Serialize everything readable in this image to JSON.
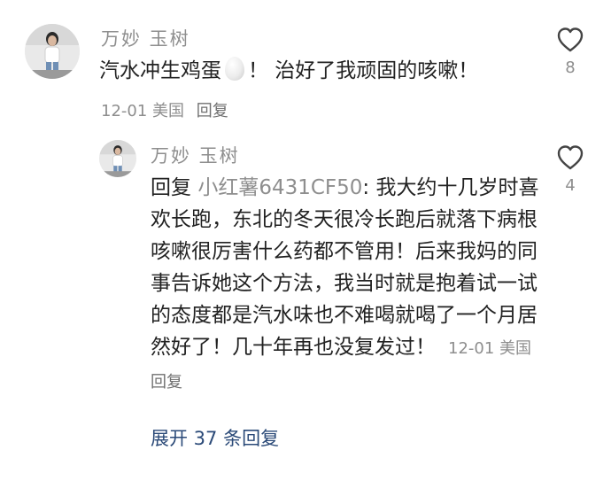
{
  "comment": {
    "username": "万妙 玉树",
    "text_before_emoji": "汽水冲生鸡蛋",
    "emoji": "egg-emoji",
    "text_after_emoji": "！ 治好了我顽固的咳嗽！",
    "date": "12-01",
    "location": "美国",
    "reply_label": "回复",
    "like_count": "8",
    "reply": {
      "username": "万妙 玉树",
      "reply_prefix": "回复",
      "mention": "小红薯6431CF50",
      "text": ": 我大约十几岁时喜欢长跑，东北的冬天很冷长跑后就落下病根咳嗽很厉害什么药都不管用！后来我妈的同事告诉她这个方法，我当时就是抱着试一试的态度都是汽水味也不难喝就喝了一个月居然好了！几十年再也没复发过！",
      "date": "12-01",
      "location": "美国",
      "reply_label": "回复",
      "like_count": "4"
    },
    "expand_label": "展开 37 条回复"
  },
  "colors": {
    "text": "#222222",
    "muted": "#8e8e8e",
    "link": "#2b4a78"
  }
}
